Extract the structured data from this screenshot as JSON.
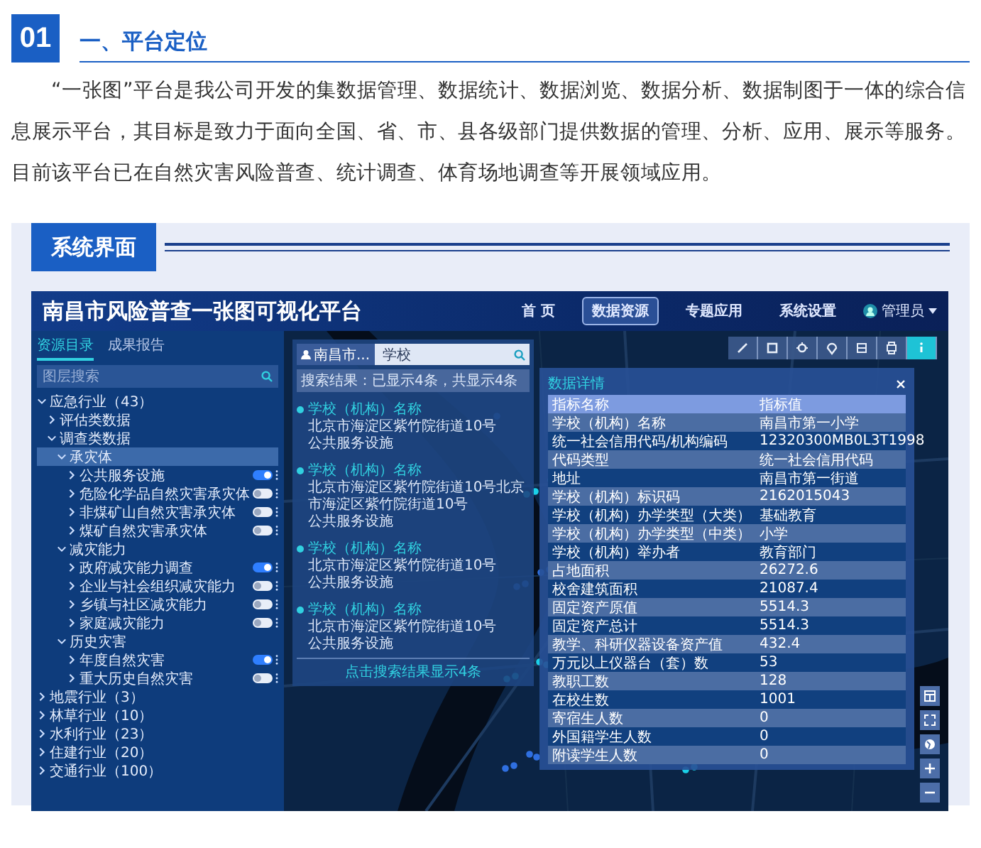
{
  "section": {
    "number": "01",
    "title": "一、平台定位"
  },
  "paragraph": "“一张图”平台是我公司开发的集数据管理、数据统计、数据浏览、数据分析、数据制图于一体的综合信息展示平台，其目标是致力于面向全国、省、市、县各级部门提供数据的管理、分析、应用、展示等服务。目前该平台已在自然灾害风险普查、统计调查、体育场地调查等开展领域应用。",
  "subsection": {
    "title": "系统界面"
  },
  "app": {
    "title": "南昌市风险普查一张图可视化平台",
    "nav": [
      {
        "label": "首 页",
        "selected": false
      },
      {
        "label": "数据资源",
        "selected": true
      },
      {
        "label": "专题应用",
        "selected": false
      },
      {
        "label": "系统设置",
        "selected": false
      }
    ],
    "user": "管理员",
    "panel_tabs": [
      {
        "label": "资源目录",
        "selected": true
      },
      {
        "label": "成果报告",
        "selected": false
      }
    ],
    "layer_search": {
      "placeholder": "图层搜索"
    },
    "tree": [
      {
        "label": "应急行业（43）",
        "selected": false,
        "expanded": true,
        "children": [
          {
            "label": "评估类数据",
            "selected": false,
            "expanded": false
          },
          {
            "label": "调查类数据",
            "selected": false,
            "expanded": true,
            "children": [
              {
                "label": "承灾体",
                "selected": true,
                "expanded": true,
                "children": [
                  {
                    "label": "公共服务设施",
                    "selected": false,
                    "on": true
                  },
                  {
                    "label": "危险化学品自然灾害承灾体",
                    "selected": false,
                    "on": false
                  },
                  {
                    "label": "非煤矿山自然灾害承灾体",
                    "selected": false,
                    "on": false
                  },
                  {
                    "label": "煤矿自然灾害承灾体",
                    "selected": false,
                    "on": false
                  }
                ]
              },
              {
                "label": "减灾能力",
                "selected": false,
                "expanded": true,
                "children": [
                  {
                    "label": "政府减灾能力调查",
                    "selected": false,
                    "on": true
                  },
                  {
                    "label": "企业与社会组织减灾能力",
                    "selected": false,
                    "on": false
                  },
                  {
                    "label": "乡镇与社区减灾能力",
                    "selected": false,
                    "on": false
                  },
                  {
                    "label": "家庭减灾能力",
                    "selected": false,
                    "on": false
                  }
                ]
              },
              {
                "label": "历史灾害",
                "selected": false,
                "expanded": true,
                "children": [
                  {
                    "label": "年度自然灾害",
                    "selected": false,
                    "on": true
                  },
                  {
                    "label": "重大历史自然灾害",
                    "selected": false,
                    "on": false
                  }
                ]
              }
            ]
          }
        ]
      },
      {
        "label": "地震行业（3）",
        "selected": false,
        "expanded": false
      },
      {
        "label": "林草行业（10）",
        "selected": false,
        "expanded": false
      },
      {
        "label": "水利行业（23）",
        "selected": false,
        "expanded": false
      },
      {
        "label": "住建行业（20）",
        "selected": false,
        "expanded": false
      },
      {
        "label": "交通行业（100）",
        "selected": false,
        "expanded": false
      }
    ],
    "search_popup": {
      "scope": "南昌市...",
      "query": "学校",
      "summary": "搜索结果：已显示4条，共显示4条",
      "results": [
        {
          "title": "学校（机构）名称",
          "address": "北京市海淀区紫竹院街道10号",
          "category": "公共服务设施"
        },
        {
          "title": "学校（机构）名称",
          "address": "北京市海淀区紫竹院街道10号北京市海淀区紫竹院街道10号",
          "category": "公共服务设施"
        },
        {
          "title": "学校（机构）名称",
          "address": "北京市海淀区紫竹院街道10号",
          "category": "公共服务设施"
        },
        {
          "title": "学校（机构）名称",
          "address": "北京市海淀区紫竹院街道10号",
          "category": "公共服务设施"
        }
      ],
      "footer": "点击搜索结果显示4条"
    },
    "toolbar": [
      {
        "kind": "ruler",
        "selected": false
      },
      {
        "kind": "area",
        "selected": false
      },
      {
        "kind": "locate",
        "selected": false
      },
      {
        "kind": "marker",
        "selected": false
      },
      {
        "kind": "list",
        "selected": false
      },
      {
        "kind": "print",
        "selected": false
      },
      {
        "kind": "info",
        "selected": true
      }
    ],
    "detail": {
      "title": "数据详情",
      "columns": [
        "指标名称",
        "指标值"
      ],
      "rows": [
        [
          "学校（机构）名称",
          "南昌市第一小学"
        ],
        [
          "统一社会信用代码/机构编码",
          "12320300MB0L3T1998"
        ],
        [
          "代码类型",
          "统一社会信用代码"
        ],
        [
          "地址",
          "南昌市第一街道"
        ],
        [
          "学校（机构）标识码",
          "2162015043"
        ],
        [
          "学校（机构）办学类型（大类）",
          "基础教育"
        ],
        [
          "学校（机构）办学类型（中类）",
          "小学"
        ],
        [
          "学校（机构）举办者",
          "教育部门"
        ],
        [
          "占地面积",
          "26272.6"
        ],
        [
          "校舍建筑面积",
          "21087.4"
        ],
        [
          "固定资产原值",
          "5514.3"
        ],
        [
          "固定资产总计",
          "5514.3"
        ],
        [
          "教学、科研仪器设备资产值",
          "432.4"
        ],
        [
          "万元以上仪器台（套）数",
          "53"
        ],
        [
          "教职工数",
          "128"
        ],
        [
          "在校生数",
          "1001"
        ],
        [
          "寄宿生人数",
          "0"
        ],
        [
          "外国籍学生人数",
          "0"
        ],
        [
          "附读学生人数",
          "0"
        ]
      ]
    }
  }
}
